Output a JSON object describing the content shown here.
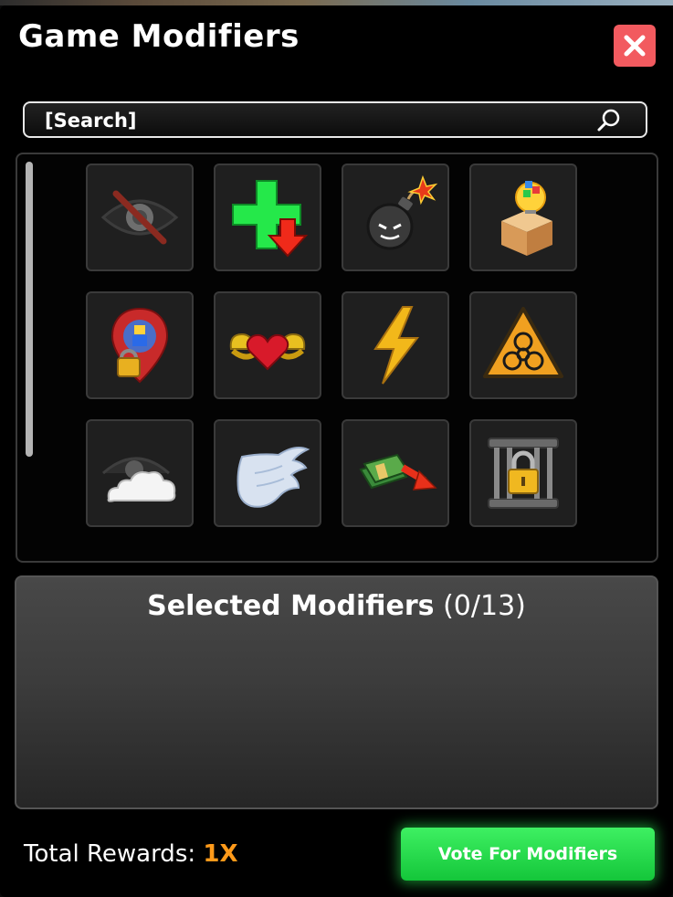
{
  "header": {
    "title": "Game Modifiers",
    "close_icon": "close-icon"
  },
  "search": {
    "value": "[Search]",
    "icon": "search-icon"
  },
  "modifiers": [
    {
      "icon": "hidden-eye-icon"
    },
    {
      "icon": "health-down-icon"
    },
    {
      "icon": "bomb-icon"
    },
    {
      "icon": "mystery-box-icon"
    },
    {
      "icon": "locked-location-icon"
    },
    {
      "icon": "strong-heart-icon"
    },
    {
      "icon": "lightning-icon"
    },
    {
      "icon": "biohazard-icon"
    },
    {
      "icon": "fog-icon"
    },
    {
      "icon": "wing-icon"
    },
    {
      "icon": "money-down-icon"
    },
    {
      "icon": "locked-cage-icon"
    }
  ],
  "selected": {
    "title": "Selected Modifiers",
    "count": "(0/13)"
  },
  "footer": {
    "rewards_label": "Total Rewards:",
    "rewards_value": "1X",
    "vote_label": "Vote For Modifiers"
  },
  "colors": {
    "close_button": "#f25a5f",
    "vote_button": "#22dd4a",
    "rewards_accent": "#ff9a1a",
    "panel_bg": "#000000"
  }
}
